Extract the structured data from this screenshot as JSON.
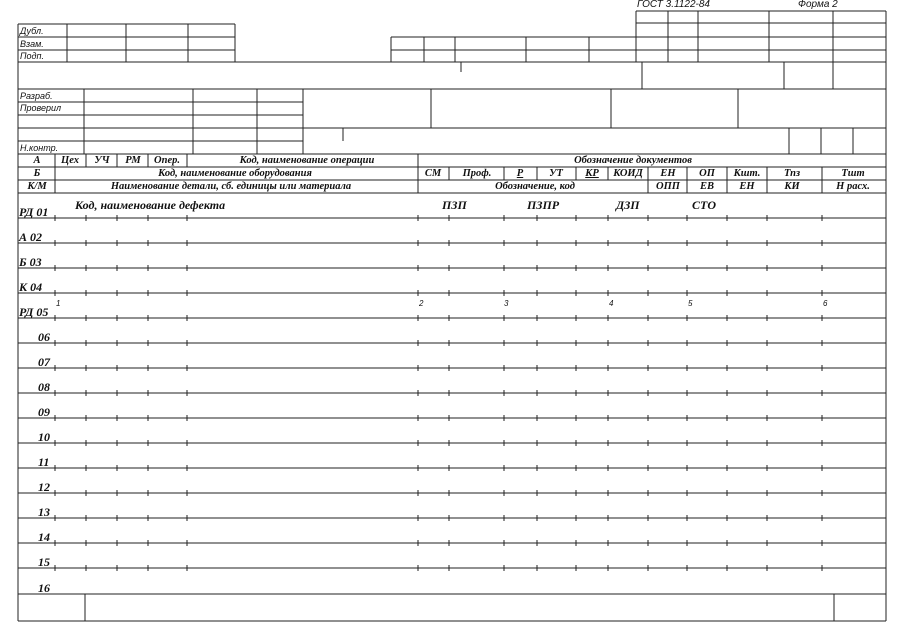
{
  "header": {
    "gost": "ГОСТ 3.1122-84",
    "form": "Форма  2"
  },
  "side_stamp": {
    "dubl": "Дубл.",
    "vzam": "Взам.",
    "podp": "Подп."
  },
  "approval": {
    "razrab": "Разраб.",
    "proveril": "Проверил",
    "n_kontr": "Н.контр."
  },
  "col_header": {
    "row_a": {
      "a": "А",
      "ceh": "Цех",
      "uch": "УЧ",
      "rm": "РМ",
      "oper": "Опер.",
      "kod_oper": "Код, наименование операции",
      "oboz_doc": "Обозначение документов"
    },
    "row_b": {
      "b": "Б",
      "kod_obor": "Код, наименование оборудования",
      "sm": "СМ",
      "prof": "Проф.",
      "r": "Р",
      "ut": "УТ",
      "kr": "КР",
      "koid": "КОИД",
      "en": "ЕН",
      "op": "ОП",
      "k_sht": "Кшт.",
      "t_pz": "Тпз",
      "t_sht": "Тшт"
    },
    "row_km": {
      "km": "К/М",
      "naim": "Наименование детали, сб. единицы или материала",
      "oboz_kod": "Обозначение, код",
      "opp": "ОПП",
      "ev": "ЕВ",
      "en": "ЕН",
      "ki": "КИ",
      "n_rash": "Н расх."
    }
  },
  "rows": {
    "r01": {
      "label": "РД  01",
      "defect": "Код, наименование дефекта",
      "pzp": "ПЗП",
      "pzpr": "ПЗПР",
      "dzp": "ДЗП",
      "sto": "СТО"
    },
    "r02": "А    02",
    "r03": "Б    03",
    "r04": "К    04",
    "r05": {
      "label": "РД  05",
      "marks": [
        "1",
        "2",
        "3",
        "4",
        "5",
        "6"
      ]
    },
    "numbers": [
      "06",
      "07",
      "08",
      "09",
      "10",
      "11",
      "12",
      "13",
      "14",
      "15",
      "16"
    ]
  }
}
